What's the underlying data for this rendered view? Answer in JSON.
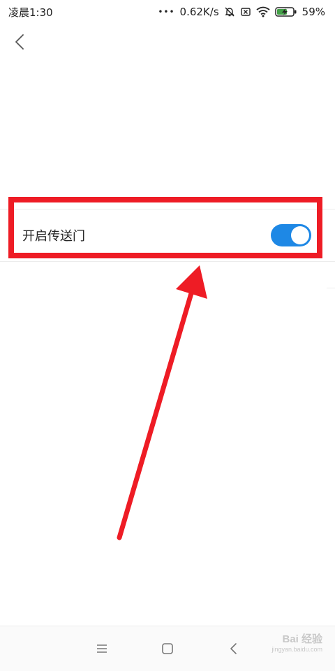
{
  "status_bar": {
    "time": "凌晨1:30",
    "dots": "•••",
    "speed": "0.62K/s",
    "battery": "59%",
    "icons": [
      "bell-mute-icon",
      "sim-disabled-icon",
      "wifi-icon",
      "battery-charging-icon"
    ]
  },
  "header": {
    "back_icon": "chevron-left-icon"
  },
  "setting": {
    "label": "开启传送门",
    "toggle_on": true,
    "accent_color": "#1e88e5"
  },
  "annotation": {
    "highlight_color": "#ee1c25"
  },
  "nav_bar": {
    "icons": [
      "menu-icon",
      "home-icon",
      "back-icon"
    ]
  },
  "watermark": {
    "main": "Bai 经验",
    "sub": "jingyan.baidu.com"
  }
}
